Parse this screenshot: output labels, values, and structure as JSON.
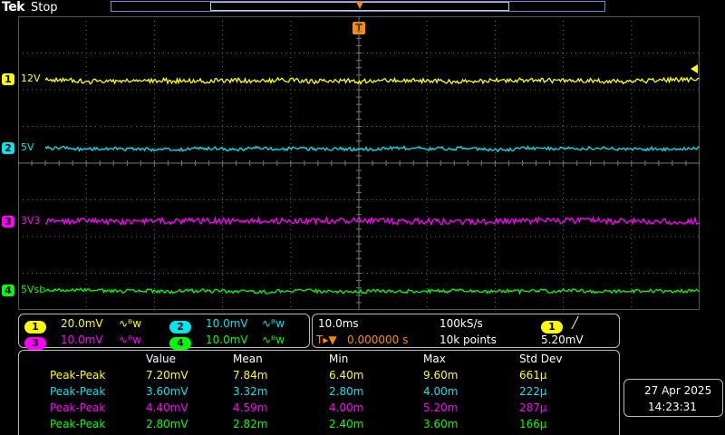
{
  "header": {
    "brand": "Tek",
    "state": "Stop"
  },
  "trigger": {
    "marker": "T"
  },
  "colors": {
    "ch1": "#ffff00",
    "ch2": "#00e5ee",
    "ch3": "#ff00ff",
    "ch4": "#00ff00",
    "grid": "#444444",
    "dots": "#666666"
  },
  "channels": [
    {
      "num": "1",
      "label": "12V",
      "scale": "20.0mV",
      "bw": "∿ᴮw"
    },
    {
      "num": "2",
      "label": "5V",
      "scale": "10.0mV",
      "bw": "∿ᴮw"
    },
    {
      "num": "3",
      "label": "3V3",
      "scale": "10.0mV",
      "bw": "∿ᴮw"
    },
    {
      "num": "4",
      "label": "5Vsb",
      "scale": "10.0mV",
      "bw": "∿ᴮw"
    }
  ],
  "timebase": {
    "scale": "10.0ms",
    "rate": "100kS/s",
    "offset": "0.000000 s",
    "points": "10k points",
    "trig_source": "1",
    "trig_slope": "╱",
    "trig_level": "5.20mV",
    "offset_prefix": "T▸▼"
  },
  "measurements": {
    "headers": [
      "Value",
      "Mean",
      "Min",
      "Max",
      "Std Dev"
    ],
    "rows": [
      {
        "ch": "1",
        "name": "Peak-Peak",
        "value": "7.20mV",
        "mean": "7.84m",
        "min": "6.40m",
        "max": "9.60m",
        "std": "661µ"
      },
      {
        "ch": "2",
        "name": "Peak-Peak",
        "value": "3.60mV",
        "mean": "3.32m",
        "min": "2.80m",
        "max": "4.00m",
        "std": "222µ"
      },
      {
        "ch": "3",
        "name": "Peak-Peak",
        "value": "4.40mV",
        "mean": "4.59m",
        "min": "4.00m",
        "max": "5.20m",
        "std": "287µ"
      },
      {
        "ch": "4",
        "name": "Peak-Peak",
        "value": "2.80mV",
        "mean": "2.82m",
        "min": "2.40m",
        "max": "3.60m",
        "std": "166µ"
      }
    ]
  },
  "datetime": {
    "date": "27 Apr  2025",
    "time": "14:23:31"
  }
}
